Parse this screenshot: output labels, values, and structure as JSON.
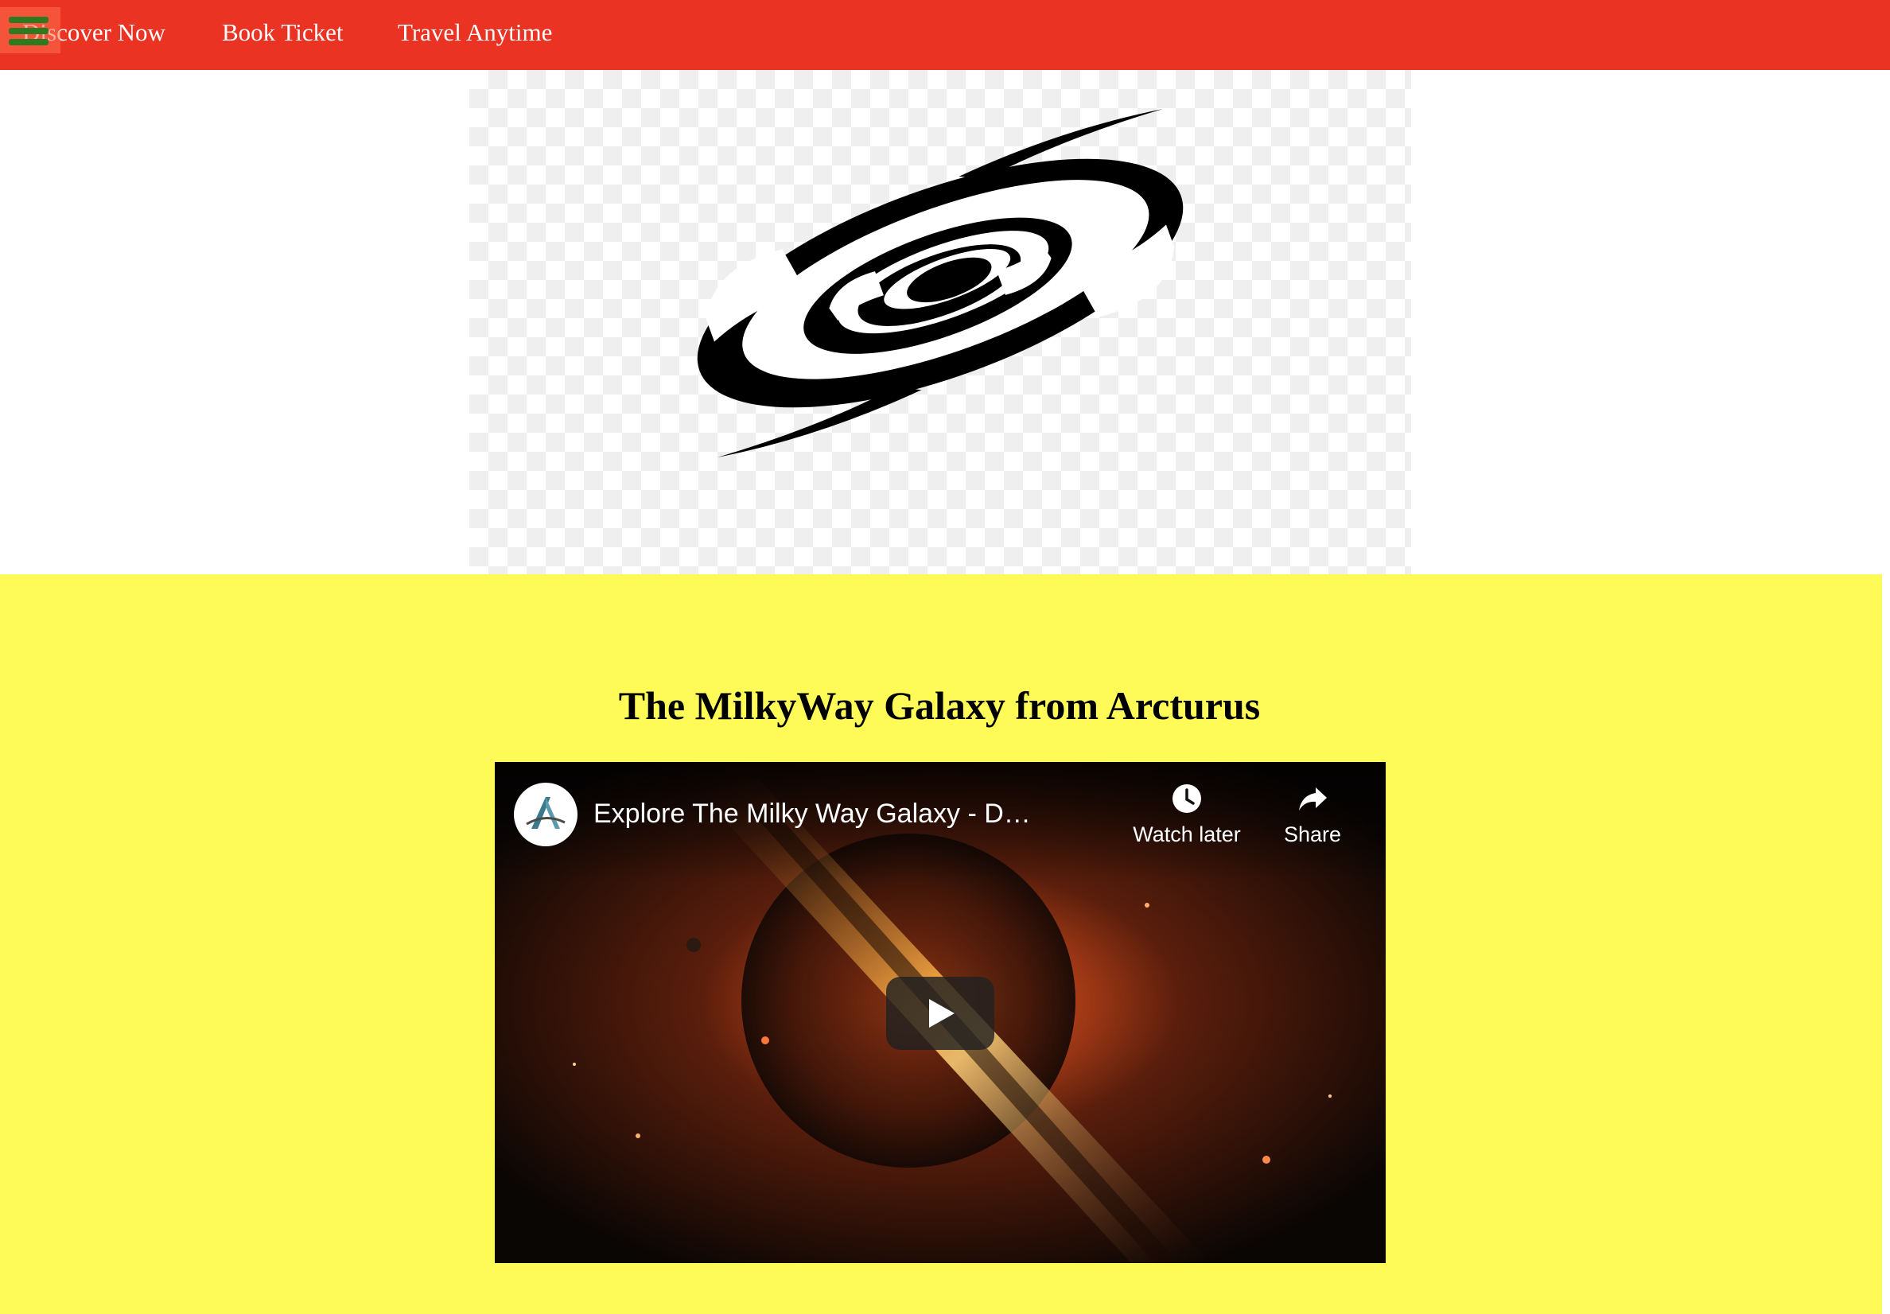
{
  "nav": {
    "menu_icon": "hamburger-menu-icon",
    "links": [
      "Discover Now",
      "Book Ticket",
      "Travel Anytime"
    ],
    "bar_color": "#ea3323",
    "menu_icon_color": "#2e7a1f"
  },
  "hero": {
    "logo_icon": "spiral-galaxy-logo",
    "background": "checkerboard"
  },
  "section": {
    "title": "The MilkyWay Galaxy from Arcturus",
    "background_color": "#fefa58"
  },
  "video": {
    "title": "Explore The Milky Way Galaxy - Docum...",
    "channel_icon": "channel-logo-icon",
    "watch_later_label": "Watch later",
    "watch_later_icon": "clock-icon",
    "share_label": "Share",
    "share_icon": "share-arrow-icon",
    "play_icon": "play-icon"
  }
}
